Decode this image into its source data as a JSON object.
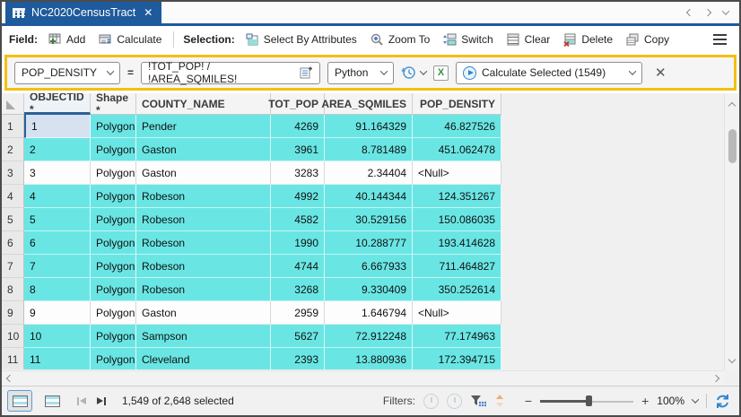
{
  "window": {
    "title": "NC2020CensusTract"
  },
  "tab": {
    "title": "NC2020CensusTract",
    "close_glyph": "✕"
  },
  "toolbar": {
    "field_label": "Field:",
    "add_label": "Add",
    "calculate_label": "Calculate",
    "selection_label": "Selection:",
    "select_by_attributes_label": "Select By Attributes",
    "zoom_to_label": "Zoom To",
    "switch_label": "Switch",
    "clear_label": "Clear",
    "delete_label": "Delete",
    "copy_label": "Copy"
  },
  "calc_bar": {
    "field_value": "POP_DENSITY",
    "equals": "=",
    "expression": "!TOT_POP! / !AREA_SQMILES!",
    "language_value": "Python",
    "validate_glyph": "X",
    "run_label": "Calculate Selected (1549)",
    "close_glyph": "✕"
  },
  "table": {
    "columns": [
      "OBJECTID *",
      "Shape *",
      "COUNTY_NAME",
      "TOT_POP",
      "AREA_SQMILES",
      "POP_DENSITY"
    ],
    "rows": [
      {
        "cells": [
          "1",
          "Polygon",
          "Pender",
          "4269",
          "91.164329",
          "46.827526"
        ],
        "selected": true
      },
      {
        "cells": [
          "2",
          "Polygon",
          "Gaston",
          "3961",
          "8.781489",
          "451.062478"
        ],
        "selected": true
      },
      {
        "cells": [
          "3",
          "Polygon",
          "Gaston",
          "3283",
          "2.34404",
          "<Null>"
        ],
        "selected": false
      },
      {
        "cells": [
          "4",
          "Polygon",
          "Robeson",
          "4992",
          "40.144344",
          "124.351267"
        ],
        "selected": true
      },
      {
        "cells": [
          "5",
          "Polygon",
          "Robeson",
          "4582",
          "30.529156",
          "150.086035"
        ],
        "selected": true
      },
      {
        "cells": [
          "6",
          "Polygon",
          "Robeson",
          "1990",
          "10.288777",
          "193.414628"
        ],
        "selected": true
      },
      {
        "cells": [
          "7",
          "Polygon",
          "Robeson",
          "4744",
          "6.667933",
          "711.464827"
        ],
        "selected": true
      },
      {
        "cells": [
          "8",
          "Polygon",
          "Robeson",
          "3268",
          "9.330409",
          "350.252614"
        ],
        "selected": true
      },
      {
        "cells": [
          "9",
          "Polygon",
          "Gaston",
          "2959",
          "1.646794",
          "<Null>"
        ],
        "selected": false
      },
      {
        "cells": [
          "10",
          "Polygon",
          "Sampson",
          "5627",
          "72.912248",
          "77.174963"
        ],
        "selected": true
      },
      {
        "cells": [
          "11",
          "Polygon",
          "Cleveland",
          "2393",
          "13.880936",
          "172.394715"
        ],
        "selected": true
      }
    ]
  },
  "status_bar": {
    "selection_text": "1,549 of 2,648 selected",
    "filters_label": "Filters:",
    "zoom_minus": "−",
    "zoom_plus": "+",
    "zoom_value": "100%"
  },
  "colors": {
    "tab_blue": "#1e5a9c",
    "highlight_yellow": "#f2c011",
    "selection_cyan": "#69e6e4",
    "active_cell_blue": "#d6e2f0",
    "accent_underline": "#2a6099",
    "refresh_blue": "#2e86d1"
  }
}
